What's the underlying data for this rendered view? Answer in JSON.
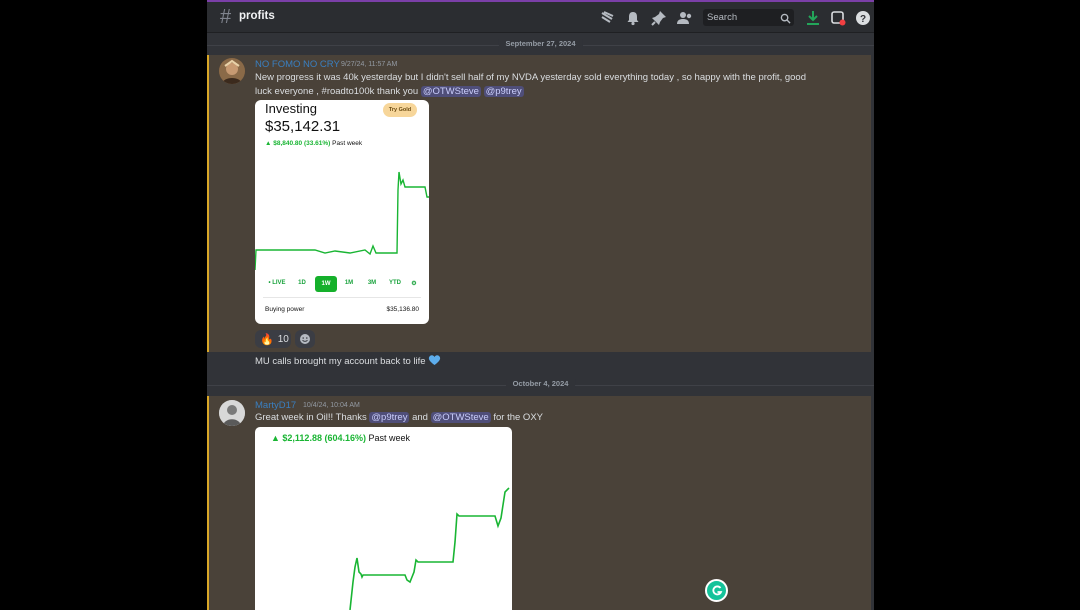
{
  "header": {
    "channel_name": "profits",
    "search_placeholder": "Search"
  },
  "dividers": [
    "September 27, 2024",
    "October 4, 2024"
  ],
  "messages": [
    {
      "username": "NO FOMO NO CRY",
      "timestamp": "9/27/24, 11:57 AM",
      "text_line1": "New progress it was 40k yesterday but I didn't sell half of my NVDA yesterday sold everything today , so happy with the profit, good",
      "text_line2_prefix": "luck everyone , #roadto100k thank you",
      "mentions": [
        "@OTWSteve",
        "@p9trey"
      ],
      "card": {
        "title": "Investing",
        "try_gold": "Try Gold",
        "value": "$35,142.31",
        "change": "▲ $8,840.80 (33.61%)",
        "period": "Past week",
        "ranges": [
          "• LIVE",
          "1D",
          "1W",
          "1M",
          "3M",
          "YTD",
          "⚙"
        ],
        "active_range": "1W",
        "buying_power_label": "Buying power",
        "buying_power_value": "$35,136.80"
      },
      "reactions": [
        {
          "emoji": "🔥",
          "count": "10"
        }
      ],
      "followup": "MU calls  brought my account back to life"
    },
    {
      "username": "MartyD17",
      "timestamp": "10/4/24, 10:04 AM",
      "text_prefix": "Great week in Oil!! Thanks",
      "mention1": "@p9trey",
      "text_mid": "and",
      "mention2": "@OTWSteve",
      "text_suffix": "for the OXY",
      "card": {
        "change": "▲ $2,112.88 (604.16%)",
        "period": "Past week"
      }
    }
  ],
  "colors": {
    "accent_bar": "#d9a728",
    "highlight_bg": "#4a4239",
    "chart_green": "#19b533",
    "username_blue": "#3a7fc0"
  }
}
